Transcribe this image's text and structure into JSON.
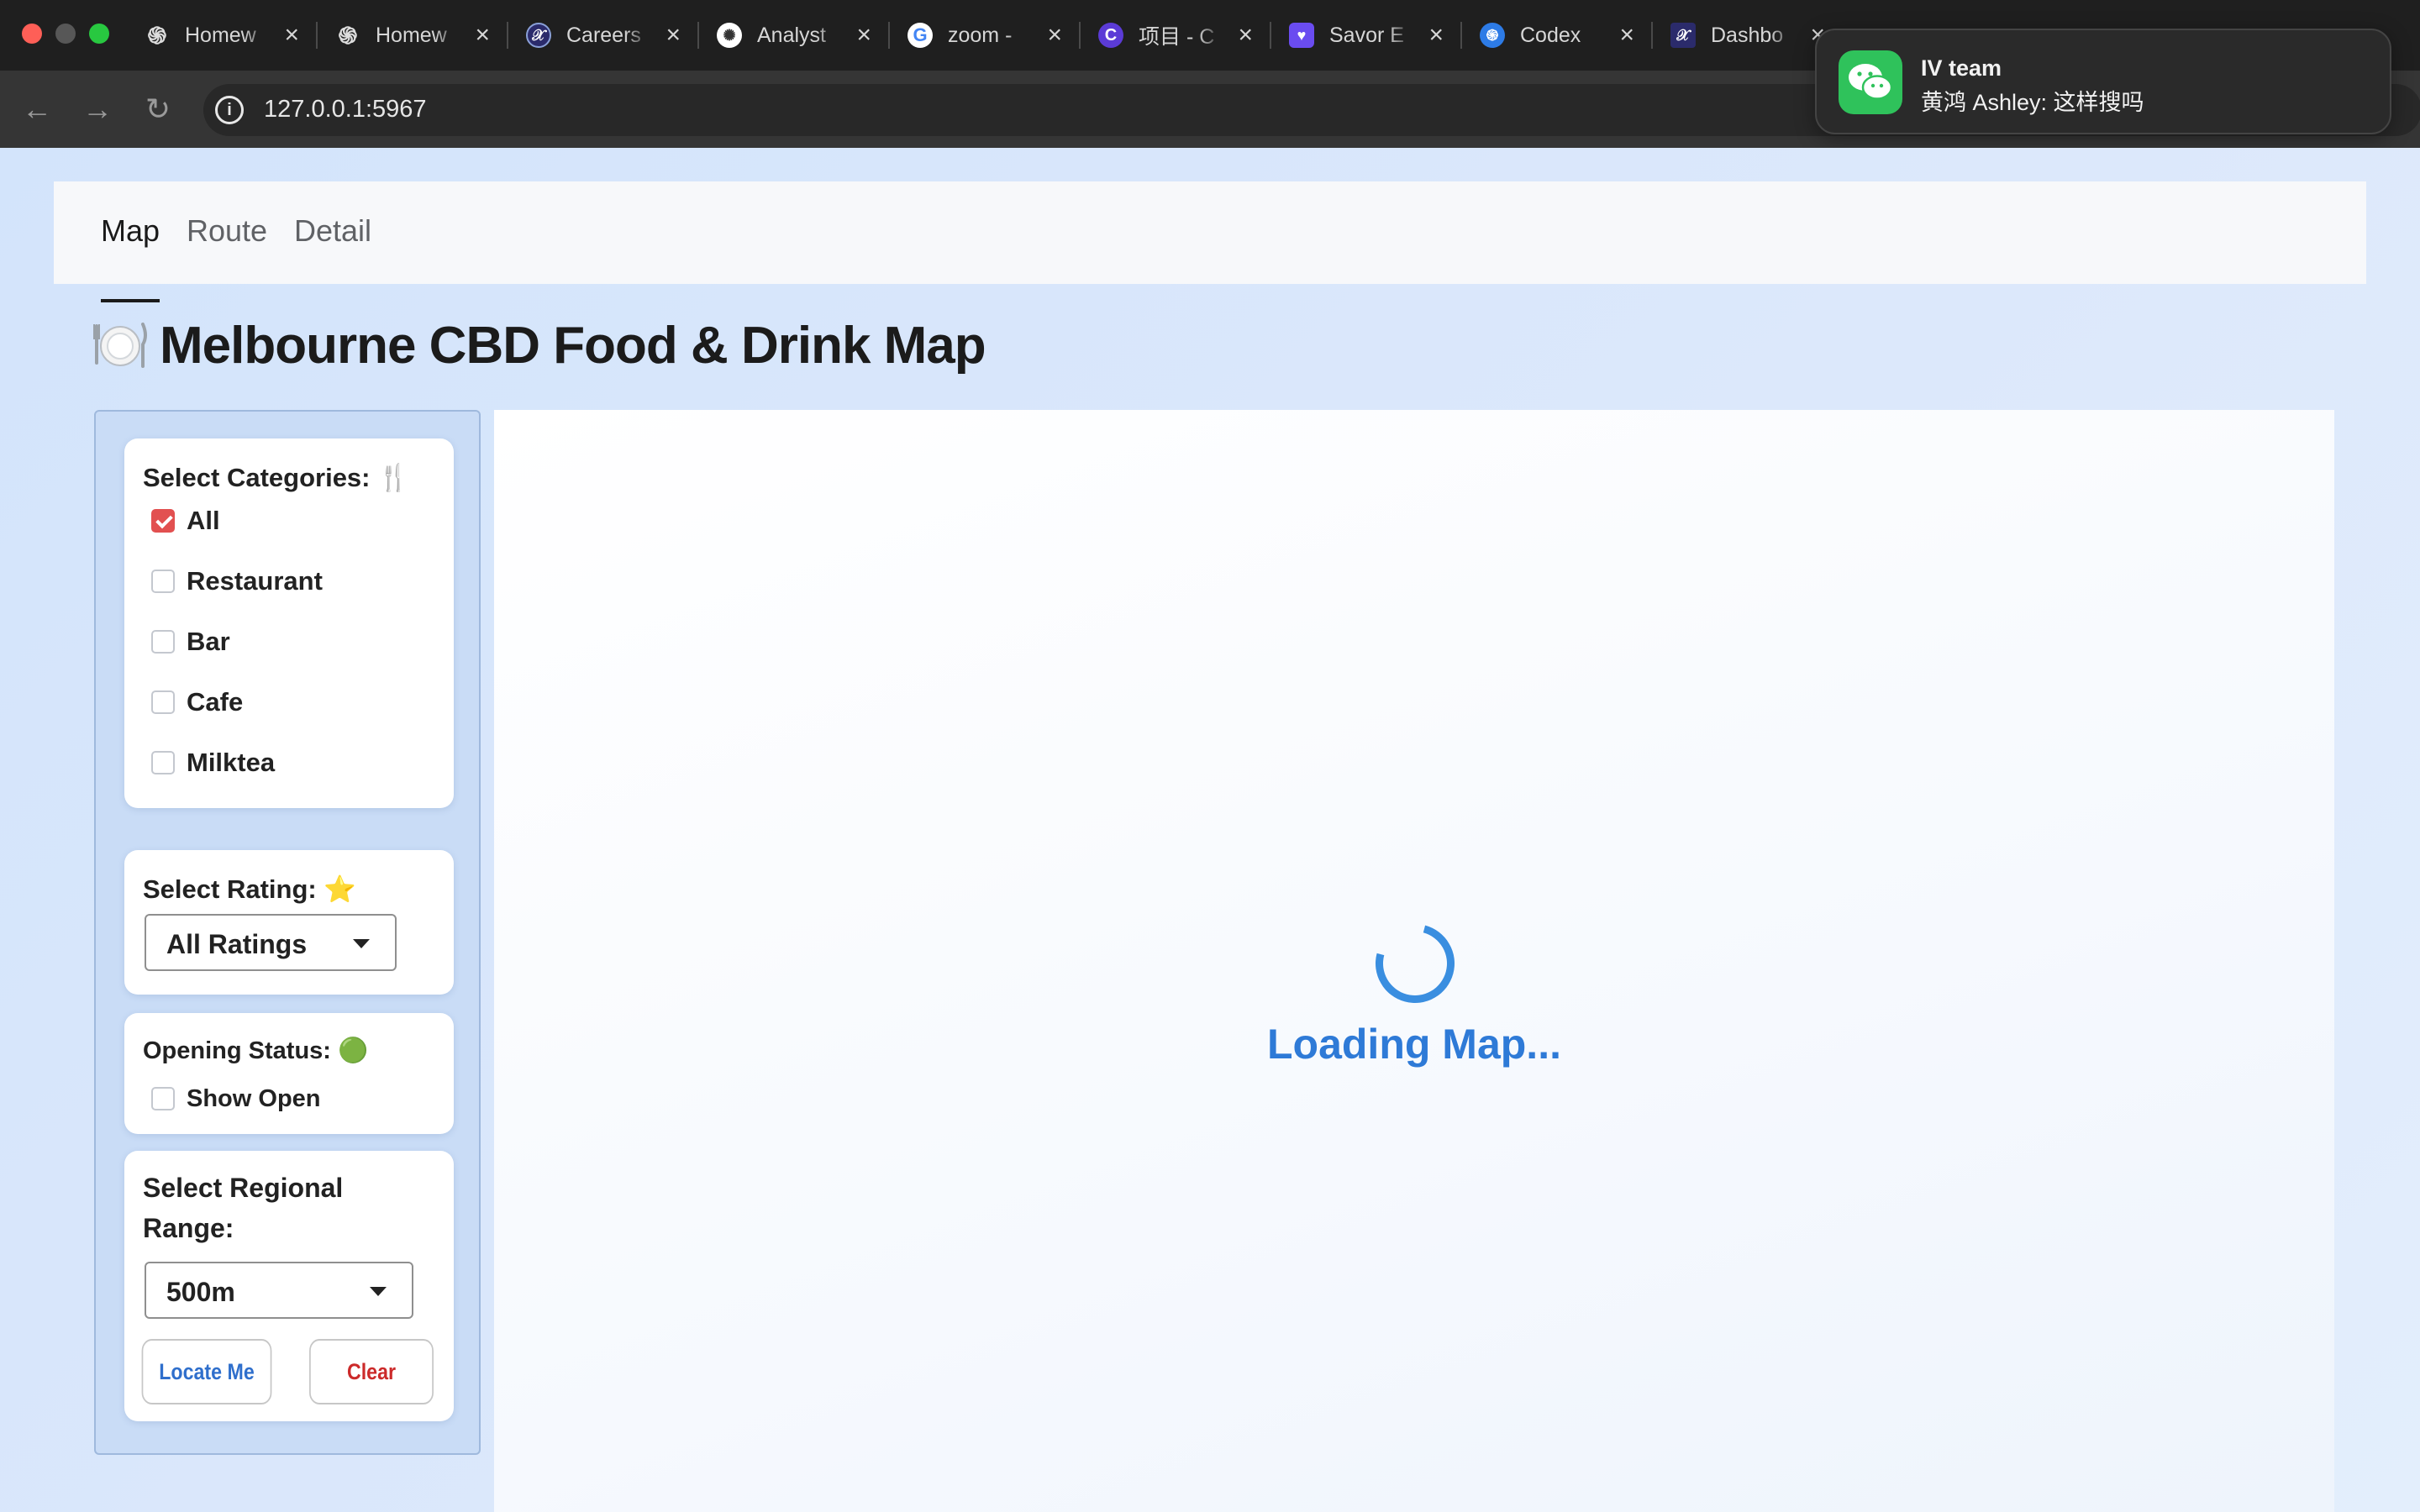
{
  "browser": {
    "tabs": [
      {
        "title": "Homew",
        "icon": "openai-icon",
        "color": "#1f1f1f"
      },
      {
        "title": "Homew",
        "icon": "openai-icon",
        "color": "#1f1f1f"
      },
      {
        "title": "Careers",
        "icon": "x-logo-icon",
        "color": "#2b2b6b"
      },
      {
        "title": "Analyst",
        "icon": "aperture-icon",
        "color": "#ffffff"
      },
      {
        "title": "zoom -",
        "icon": "google-icon",
        "color": "#ffffff"
      },
      {
        "title": "项目 - C",
        "icon": "c-logo-icon",
        "color": "#5b3bd6"
      },
      {
        "title": "Savor E",
        "icon": "savor-icon",
        "color": "#6a4cf0"
      },
      {
        "title": "Codex",
        "icon": "codex-icon",
        "color": "#2d7be6"
      },
      {
        "title": "Dashbo",
        "icon": "x-logo-icon",
        "color": "#2b2b6b"
      }
    ],
    "url": "127.0.0.1:5967"
  },
  "notification": {
    "app_icon": "wechat-icon",
    "title": "IV team",
    "message": "黄鸿 Ashley: 这样搜吗"
  },
  "nav": {
    "tabs": [
      "Map",
      "Route",
      "Detail"
    ],
    "active": "Map"
  },
  "page": {
    "title_icon": "plate-cutlery-icon",
    "title": "Melbourne CBD Food & Drink Map"
  },
  "filters": {
    "categories_label": "Select Categories: 🍴",
    "categories": [
      {
        "label": "All",
        "checked": true
      },
      {
        "label": "Restaurant",
        "checked": false
      },
      {
        "label": "Bar",
        "checked": false
      },
      {
        "label": "Cafe",
        "checked": false
      },
      {
        "label": "Milktea",
        "checked": false
      }
    ],
    "rating_label": "Select Rating: ⭐",
    "rating_value": "All Ratings",
    "opening_label": "Opening Status: 🟢",
    "opening_option": "Show Open",
    "opening_checked": false,
    "region_label_line1": "Select Regional",
    "region_label_line2": "Range:",
    "region_value": "500m",
    "locate_button": "Locate Me",
    "clear_button": "Clear"
  },
  "map": {
    "loading_text": "Loading Map..."
  }
}
